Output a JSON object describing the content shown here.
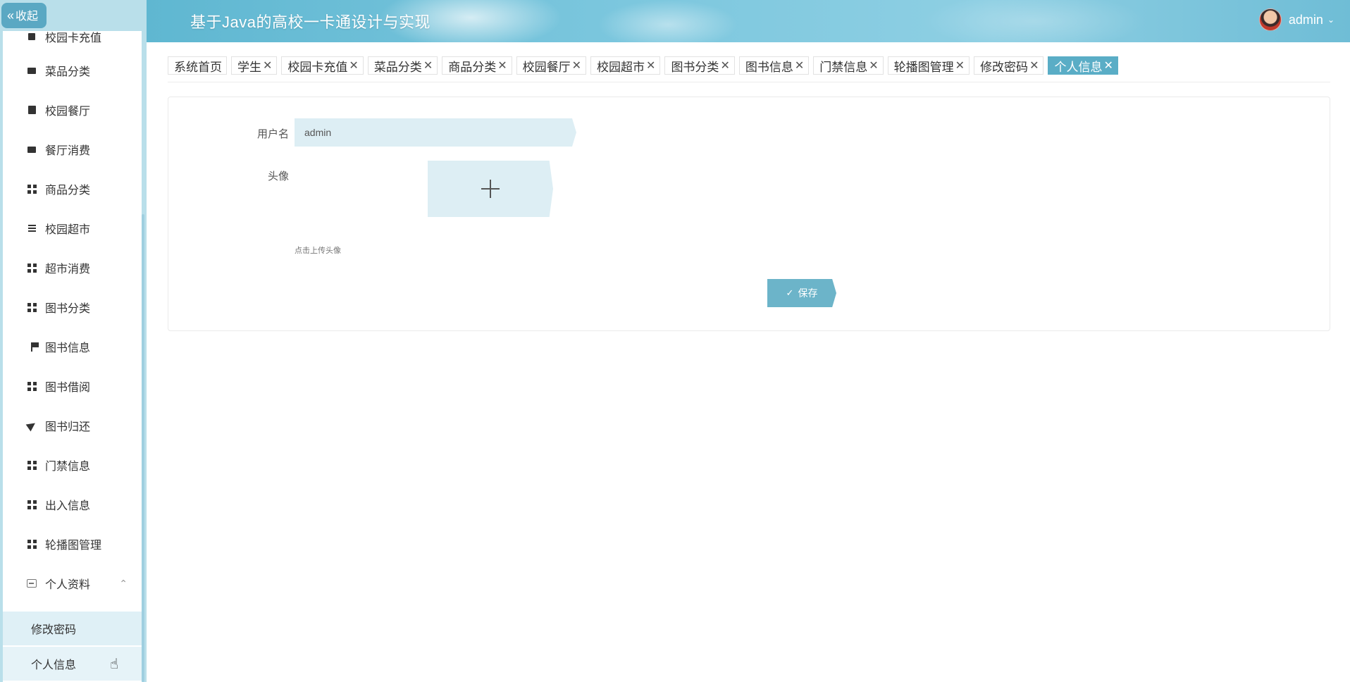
{
  "header": {
    "title": "基于Java的高校一卡通设计与实现",
    "username": "admin"
  },
  "sidebar": {
    "collapse_label": "收起",
    "items": [
      {
        "label": "校园卡充值",
        "icon": "card-icon"
      },
      {
        "label": "菜品分类",
        "icon": "chat-icon"
      },
      {
        "label": "校园餐厅",
        "icon": "box-icon"
      },
      {
        "label": "餐厅消费",
        "icon": "chat-icon"
      },
      {
        "label": "商品分类",
        "icon": "grid-icon"
      },
      {
        "label": "校园超市",
        "icon": "list-icon"
      },
      {
        "label": "超市消费",
        "icon": "grid-icon"
      },
      {
        "label": "图书分类",
        "icon": "grid-icon"
      },
      {
        "label": "图书信息",
        "icon": "flag-icon"
      },
      {
        "label": "图书借阅",
        "icon": "grid-icon"
      },
      {
        "label": "图书归还",
        "icon": "send-icon"
      },
      {
        "label": "门禁信息",
        "icon": "grid-icon"
      },
      {
        "label": "出入信息",
        "icon": "grid-icon"
      },
      {
        "label": "轮播图管理",
        "icon": "grid-icon"
      }
    ],
    "group": {
      "label": "个人资料",
      "children": [
        {
          "label": "修改密码"
        },
        {
          "label": "个人信息"
        }
      ]
    }
  },
  "tabs": [
    {
      "label": "系统首页",
      "closable": false
    },
    {
      "label": "学生",
      "closable": true
    },
    {
      "label": "校园卡充值",
      "closable": true
    },
    {
      "label": "菜品分类",
      "closable": true
    },
    {
      "label": "商品分类",
      "closable": true
    },
    {
      "label": "校园餐厅",
      "closable": true
    },
    {
      "label": "校园超市",
      "closable": true
    },
    {
      "label": "图书分类",
      "closable": true
    },
    {
      "label": "图书信息",
      "closable": true
    },
    {
      "label": "门禁信息",
      "closable": true
    },
    {
      "label": "轮播图管理",
      "closable": true
    },
    {
      "label": "修改密码",
      "closable": true
    },
    {
      "label": "个人信息",
      "closable": true,
      "active": true
    }
  ],
  "form": {
    "username_label": "用户名",
    "username_value": "admin",
    "avatar_label": "头像",
    "upload_hint": "点击上传头像",
    "save_label": "保存"
  },
  "colors": {
    "accent": "#5aadc6",
    "sidebar_bg": "#b9dfea",
    "input_bg": "#ddeef4"
  }
}
